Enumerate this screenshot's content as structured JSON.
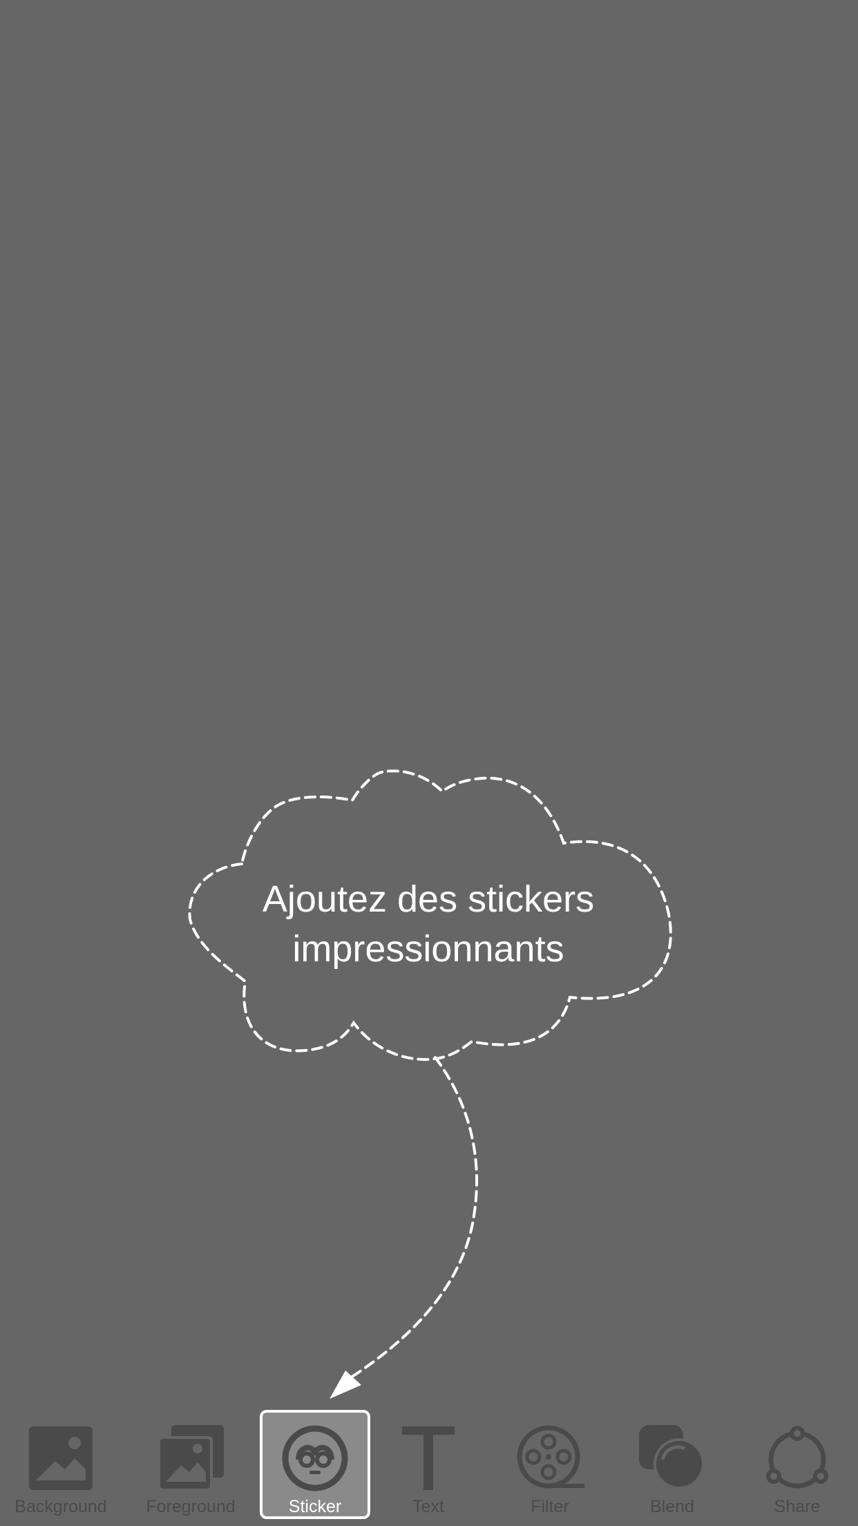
{
  "tooltip": {
    "line1": "Ajoutez des stickers",
    "line2": "impressionnants"
  },
  "toolbar": {
    "items": [
      {
        "label": "Background",
        "icon": "background-image-icon",
        "active": false
      },
      {
        "label": "Foreground",
        "icon": "foreground-images-icon",
        "active": false
      },
      {
        "label": "Sticker",
        "icon": "sticker-face-icon",
        "active": true
      },
      {
        "label": "Text",
        "icon": "text-t-icon",
        "active": false
      },
      {
        "label": "Filter",
        "icon": "film-reel-icon",
        "active": false
      },
      {
        "label": "Blend",
        "icon": "blend-circles-icon",
        "active": false
      },
      {
        "label": "Share",
        "icon": "share-nodes-icon",
        "active": false
      }
    ]
  },
  "colors": {
    "background": "#666666",
    "icon": "#4a4a4a",
    "highlight": "#ffffff",
    "active_fill": "#8a8a8a"
  }
}
